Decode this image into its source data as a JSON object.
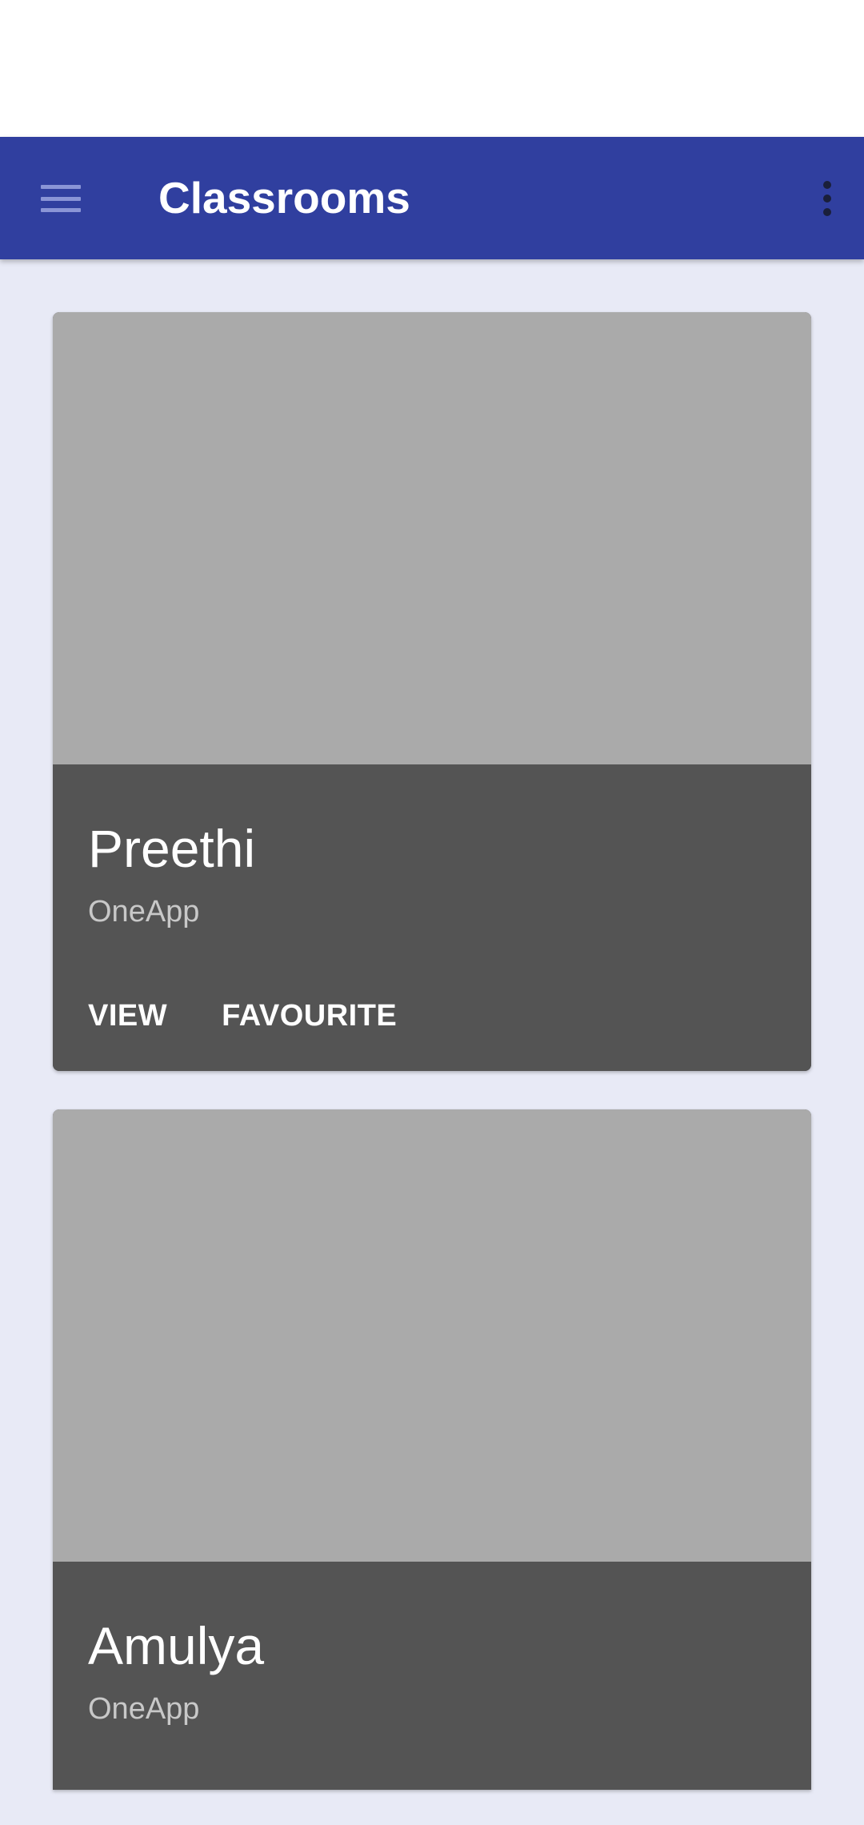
{
  "app_bar": {
    "title": "Classrooms",
    "menu_icon": "hamburger-menu-icon",
    "overflow_icon": "more-vert-icon"
  },
  "colors": {
    "app_bar": "#303f9f",
    "background": "#e8eaf6",
    "card_image": "#aaaaaa",
    "card_body": "#545454"
  },
  "classrooms": [
    {
      "name": "Preethi",
      "subtitle": "OneApp",
      "actions": [
        "VIEW",
        "FAVOURITE"
      ]
    },
    {
      "name": "Amulya",
      "subtitle": "OneApp",
      "actions": []
    }
  ]
}
